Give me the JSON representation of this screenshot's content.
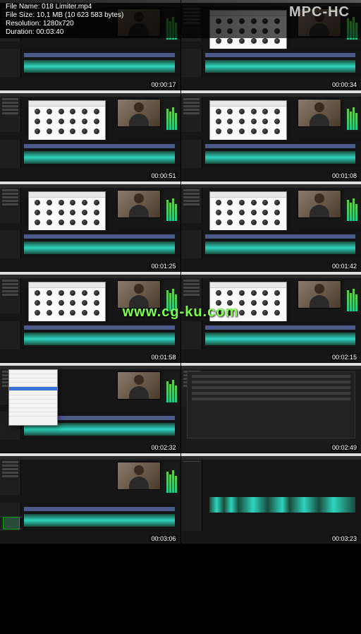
{
  "header": {
    "filename_label": "File Name:",
    "filename": "018 Limiter.mp4",
    "filesize_label": "File Size:",
    "filesize": "10,1 MB (10 623 583 bytes)",
    "resolution_label": "Resolution:",
    "resolution": "1280x720",
    "duration_label": "Duration:",
    "duration": "00:03:40",
    "app": "MPC-HC"
  },
  "watermark": "www.cg-ku.com",
  "thumbs": [
    {
      "ts": "00:00:17",
      "variant": "preview"
    },
    {
      "ts": "00:00:34",
      "variant": "plugin"
    },
    {
      "ts": "00:00:51",
      "variant": "plugin"
    },
    {
      "ts": "00:01:08",
      "variant": "plugin"
    },
    {
      "ts": "00:01:25",
      "variant": "plugin"
    },
    {
      "ts": "00:01:42",
      "variant": "plugin"
    },
    {
      "ts": "00:01:58",
      "variant": "plugin"
    },
    {
      "ts": "00:02:15",
      "variant": "plugin"
    },
    {
      "ts": "00:02:32",
      "variant": "filemenu"
    },
    {
      "ts": "00:02:49",
      "variant": "darkfull"
    },
    {
      "ts": "00:03:06",
      "variant": "preview-bin"
    },
    {
      "ts": "00:03:23",
      "variant": "waveform"
    }
  ]
}
